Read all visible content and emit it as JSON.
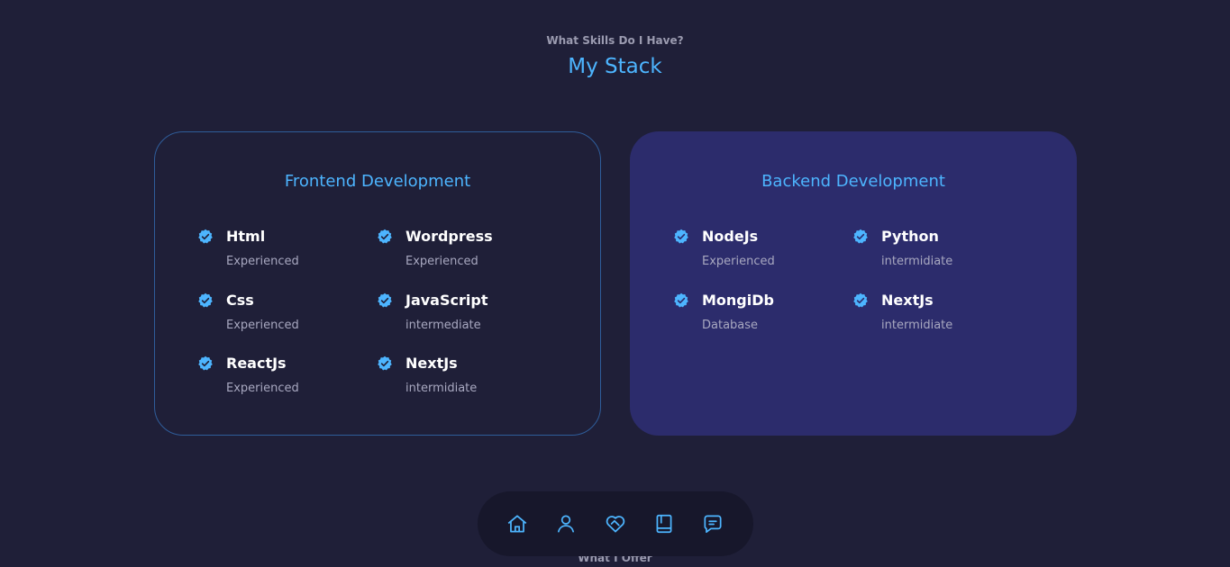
{
  "section": {
    "eyebrow": "What Skills Do I Have?",
    "title": "My Stack"
  },
  "frontend": {
    "title": "Frontend Development",
    "skills": [
      {
        "name": "Html",
        "level": "Experienced"
      },
      {
        "name": "Wordpress",
        "level": "Experienced"
      },
      {
        "name": "Css",
        "level": "Experienced"
      },
      {
        "name": "JavaScript",
        "level": "intermediate"
      },
      {
        "name": "ReactJs",
        "level": "Experienced"
      },
      {
        "name": "NextJs",
        "level": "intermidiate"
      }
    ]
  },
  "backend": {
    "title": "Backend Development",
    "skills": [
      {
        "name": "NodeJs",
        "level": "Experienced"
      },
      {
        "name": "Python",
        "level": "intermidiate"
      },
      {
        "name": "MongiDb",
        "level": "Database"
      },
      {
        "name": "NextJs",
        "level": "intermidiate"
      }
    ]
  },
  "nav": {
    "items": [
      {
        "icon": "home-icon"
      },
      {
        "icon": "user-icon"
      },
      {
        "icon": "handshake-icon"
      },
      {
        "icon": "book-icon"
      },
      {
        "icon": "message-icon"
      }
    ]
  },
  "next_section": {
    "eyebrow": "What I Offer"
  },
  "colors": {
    "background": "#1f1f38",
    "accent": "#4db5ff",
    "card_alt": "#2c2c6c",
    "text_muted": "#a8a8c0"
  }
}
